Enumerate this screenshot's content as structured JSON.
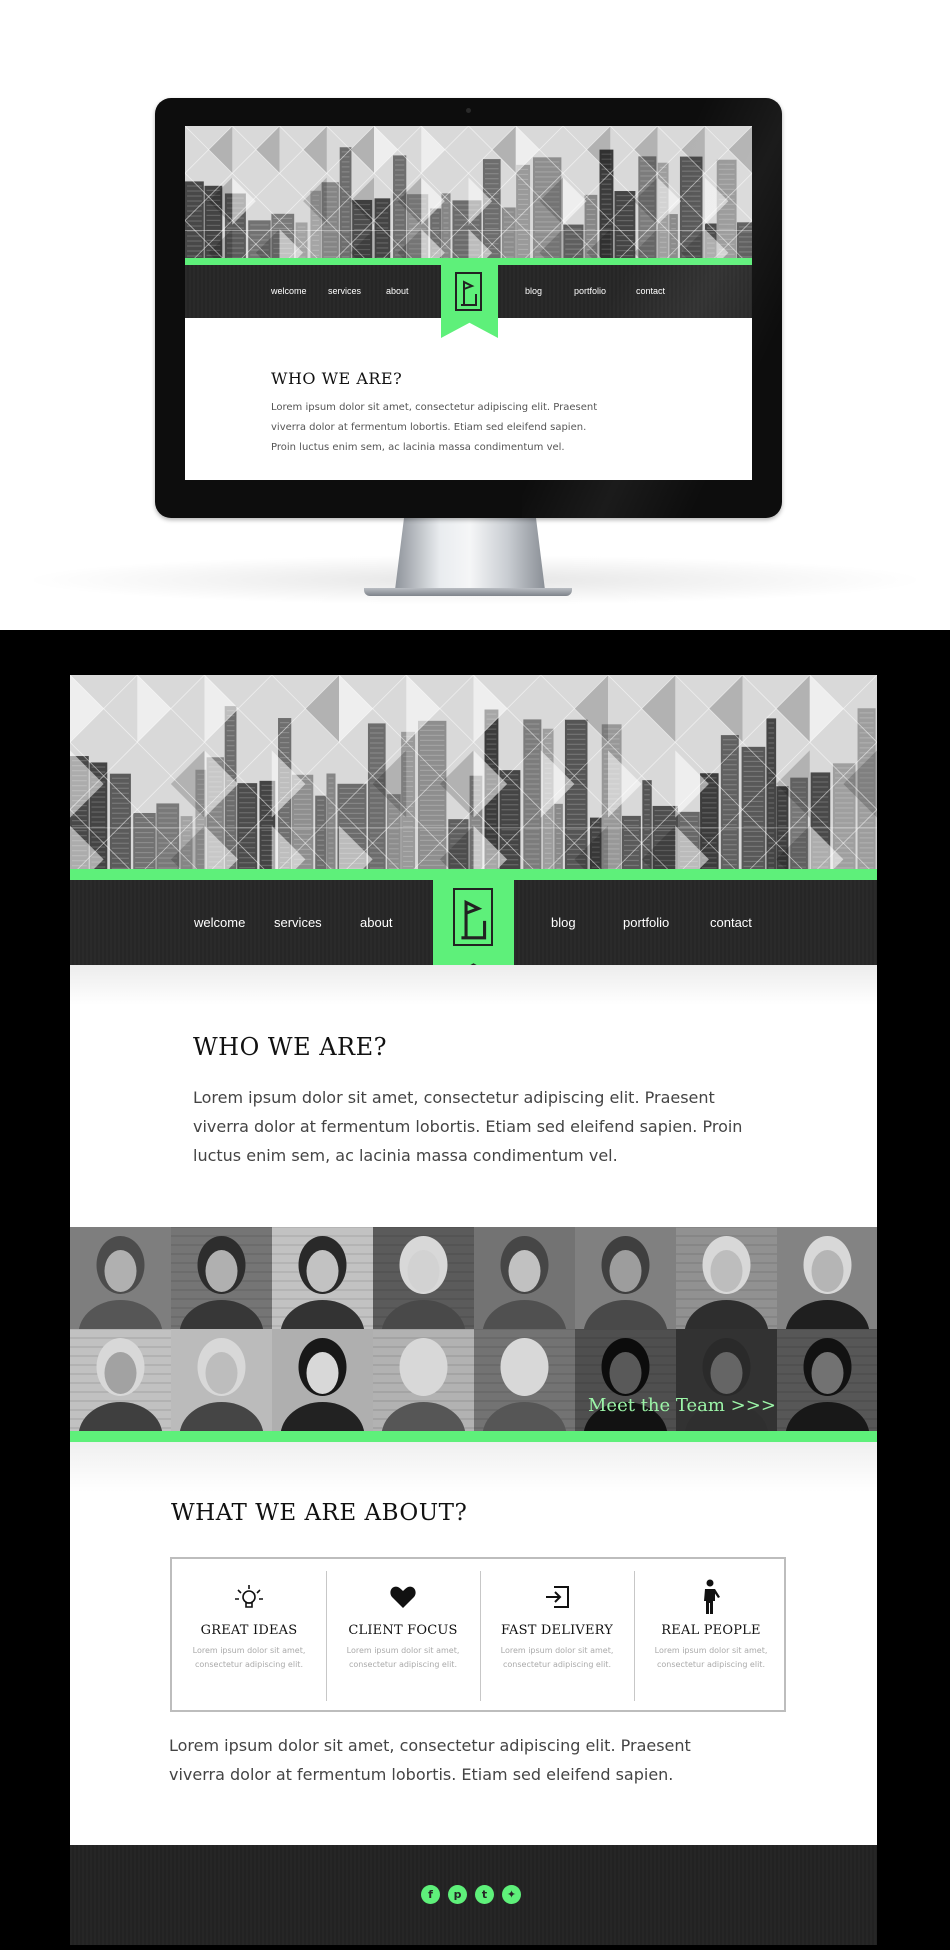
{
  "colors": {
    "accent": "#5ef07a",
    "dark": "#262626",
    "team_link": "#9cf5a8"
  },
  "nav": {
    "welcome": "welcome",
    "services": "services",
    "about": "about",
    "blog": "blog",
    "portfolio": "portfolio",
    "contact": "contact"
  },
  "logo": {
    "icon": "flag-logo-icon"
  },
  "who": {
    "title": "WHO WE ARE?",
    "text": "Lorem ipsum dolor sit amet, consectetur adipiscing elit. Praesent viverra dolor at fermentum lobortis. Etiam sed eleifend sapien. Proin luctus enim sem, ac lacinia massa condimentum vel."
  },
  "team": {
    "link": "Meet the Team >>>"
  },
  "about": {
    "title": "WHAT WE ARE ABOUT?",
    "features": [
      {
        "icon": "lightbulb-icon",
        "title": "GREAT IDEAS",
        "text": "Lorem ipsum dolor sit amet, consectetur adipiscing elit."
      },
      {
        "icon": "heart-icon",
        "title": "CLIENT FOCUS",
        "text": "Lorem ipsum dolor sit amet, consectetur adipiscing elit."
      },
      {
        "icon": "login-arrow-icon",
        "title": "FAST DELIVERY",
        "text": "Lorem ipsum dolor sit amet, consectetur adipiscing elit."
      },
      {
        "icon": "person-icon",
        "title": "REAL PEOPLE",
        "text": "Lorem ipsum dolor sit amet, consectetur adipiscing elit."
      }
    ],
    "text": "Lorem ipsum dolor sit amet, consectetur adipiscing elit. Praesent viverra dolor at fermentum lobortis. Etiam sed eleifend sapien."
  },
  "footer": {
    "social": [
      {
        "icon": "facebook-icon",
        "glyph": "f"
      },
      {
        "icon": "pinterest-icon",
        "glyph": "p"
      },
      {
        "icon": "tumblr-icon",
        "glyph": "t"
      },
      {
        "icon": "twitter-icon",
        "glyph": "✦"
      }
    ]
  }
}
